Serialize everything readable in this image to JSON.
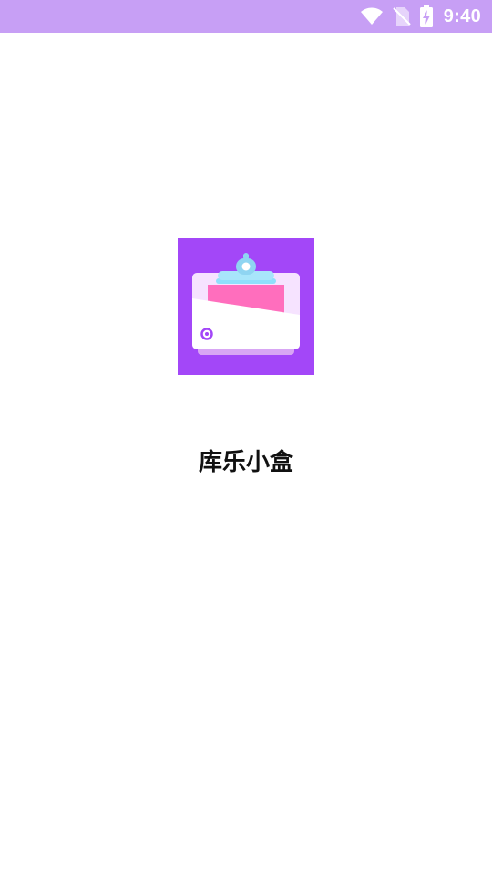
{
  "status_bar": {
    "time": "9:40",
    "background_color": "#c79ff5",
    "icons": [
      "wifi-icon",
      "no-sim-icon",
      "battery-charging-icon"
    ]
  },
  "splash": {
    "app_name": "库乐小盒",
    "logo_icon": "clipboard-box-icon",
    "logo_background_color": "#a347f8"
  }
}
